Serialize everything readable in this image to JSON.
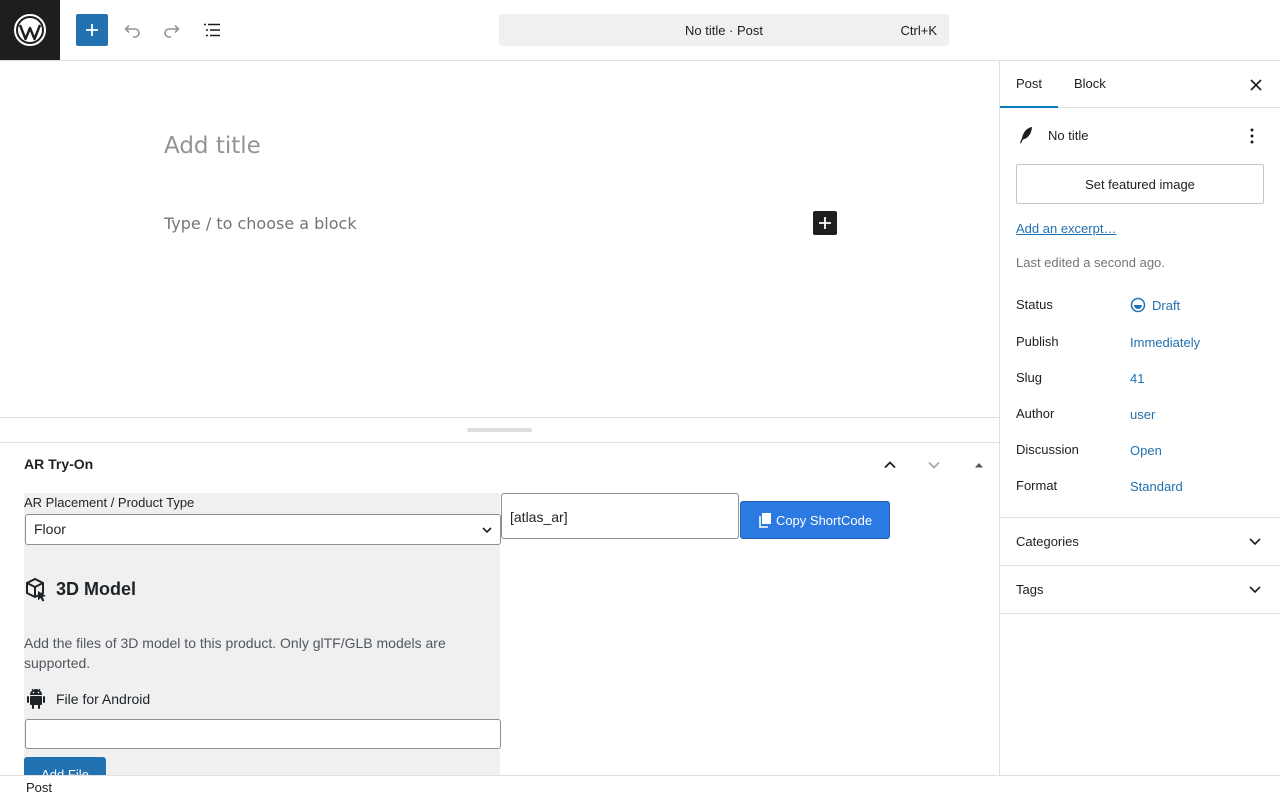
{
  "header": {
    "command_bar": "No title · Post",
    "shortcut": "Ctrl+K"
  },
  "canvas": {
    "title_placeholder": "Add title",
    "block_placeholder": "Type / to choose a block"
  },
  "metabox": {
    "title": "AR Try-On",
    "placement_label": "AR Placement / Product Type",
    "placement_value": "Floor",
    "shortcode_value": "[atlas_ar]",
    "copy_button": "Copy ShortCode",
    "model_heading": "3D Model",
    "model_description": "Add the files of 3D model to this product. Only glTF/GLB models are supported.",
    "android_label": "File for Android",
    "add_file_button": "Add File"
  },
  "sidebar": {
    "tabs": [
      "Post",
      "Block"
    ],
    "post_title": "No title",
    "featured_image_button": "Set featured image",
    "excerpt_link": "Add an excerpt…",
    "last_edited": "Last edited a second ago.",
    "rows": [
      {
        "label": "Status",
        "value": "Draft"
      },
      {
        "label": "Publish",
        "value": "Immediately"
      },
      {
        "label": "Slug",
        "value": "41"
      },
      {
        "label": "Author",
        "value": "user"
      },
      {
        "label": "Discussion",
        "value": "Open"
      },
      {
        "label": "Format",
        "value": "Standard"
      }
    ],
    "panels": [
      "Categories",
      "Tags"
    ]
  },
  "footer": {
    "breadcrumb": "Post"
  },
  "colors": {
    "accent": "#2271b1",
    "copy_button": "#2a7ae2",
    "dark": "#1e1e1e"
  }
}
